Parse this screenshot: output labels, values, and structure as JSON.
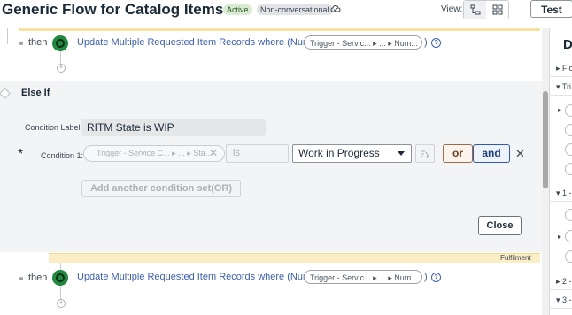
{
  "header": {
    "title": "Generic Flow for Catalog Items",
    "status_badge": "Active",
    "type_badge": "Non-conversational",
    "view_label": "View:",
    "test_label": "Test"
  },
  "steps": [
    {
      "then_label": "then",
      "action_text": "Update Multiple Requested Item Records where (Number is",
      "pill_text": "Trigger - Servic... ▸ ... ▸ Num...",
      "close_paren": ")"
    },
    {
      "then_label": "then",
      "action_text": "Update Multiple Requested Item Records where (Number is",
      "pill_text": "Trigger - Servic... ▸ ... ▸ Num...",
      "close_paren": ")"
    }
  ],
  "else_if": {
    "title": "Else If",
    "condition_label_caption": "Condition Label:",
    "condition_label_value": "RITM State is WIP",
    "condition_caption": "Condition 1:",
    "required_mark": "*",
    "trigger_pill": "Trigger - Service C... ▸ ... ▸ Sta...",
    "operator": "is",
    "value": "Work in Progress",
    "or_label": "or",
    "and_label": "and",
    "add_condition_set": "Add another condition set(OR)",
    "close_label": "Close"
  },
  "fulfilment_label": "Fulfilment",
  "right_panel": {
    "title": "D",
    "rows": [
      "▸ Flo",
      "▾ Tri",
      "▾ 1 -",
      "▸ 2 -",
      "▾ 3 -"
    ]
  },
  "colors": {
    "link": "#3a5fb8",
    "step_green": "#1f8a3d",
    "or_border": "#9b6b4a",
    "and_border": "#2e5aa8",
    "fulfilment_band": "#fbeec4"
  }
}
